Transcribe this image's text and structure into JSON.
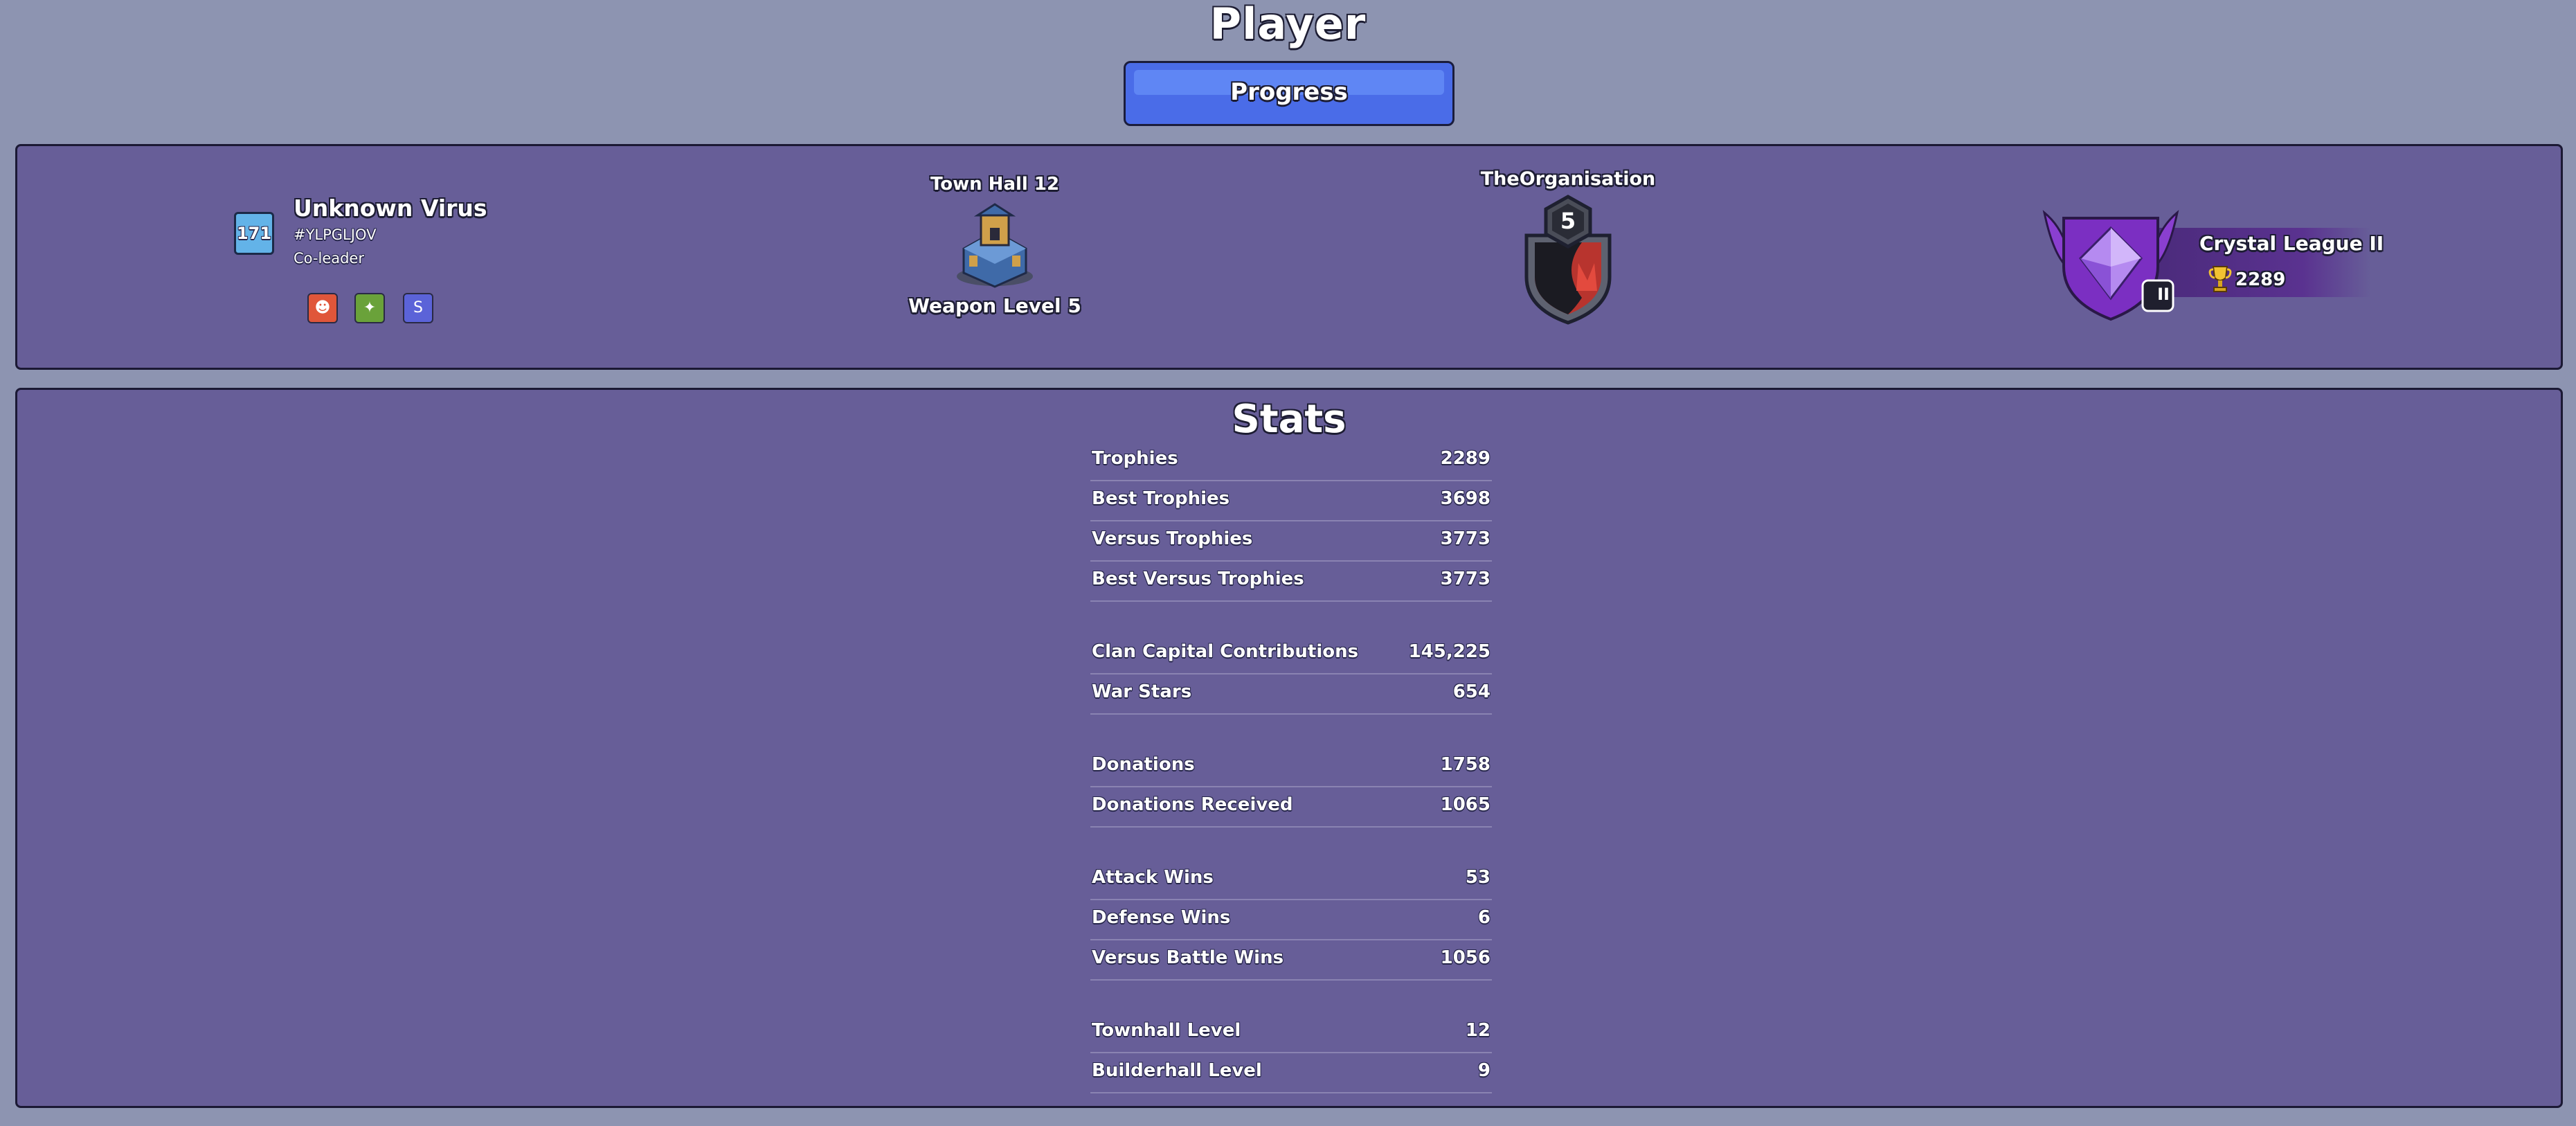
{
  "header": {
    "title": "Player",
    "progress_label": "Progress"
  },
  "player": {
    "exp_level": "171",
    "name": "Unknown Virus",
    "tag": "#YLPGLJOV",
    "role": "Co-leader",
    "labels": [
      {
        "icon": "active-daily-label-icon",
        "color": "#e0563a"
      },
      {
        "icon": "clan-wars-label-icon",
        "color": "#6aa23a"
      },
      {
        "icon": "builder-base-label-icon",
        "color": "#5b63d8"
      }
    ]
  },
  "townhall": {
    "title": "Town Hall 12",
    "weapon": "Weapon Level 5"
  },
  "clan": {
    "name": "TheOrganisation",
    "level": "5"
  },
  "league": {
    "name": "Crystal League II",
    "trophies": "2289",
    "tier_mark": "II"
  },
  "stats": {
    "title": "Stats",
    "groups": [
      [
        {
          "label": "Trophies",
          "value": "2289"
        },
        {
          "label": "Best Trophies",
          "value": "3698"
        },
        {
          "label": "Versus Trophies",
          "value": "3773"
        },
        {
          "label": "Best Versus Trophies",
          "value": "3773"
        }
      ],
      [
        {
          "label": "Clan Capital Contributions",
          "value": "145,225"
        },
        {
          "label": "War Stars",
          "value": "654"
        }
      ],
      [
        {
          "label": "Donations",
          "value": "1758"
        },
        {
          "label": "Donations Received",
          "value": "1065"
        }
      ],
      [
        {
          "label": "Attack Wins",
          "value": "53"
        },
        {
          "label": "Defense Wins",
          "value": "6"
        },
        {
          "label": "Versus Battle Wins",
          "value": "1056"
        }
      ],
      [
        {
          "label": "Townhall Level",
          "value": "12"
        },
        {
          "label": "Builderhall Level",
          "value": "9"
        }
      ]
    ]
  }
}
